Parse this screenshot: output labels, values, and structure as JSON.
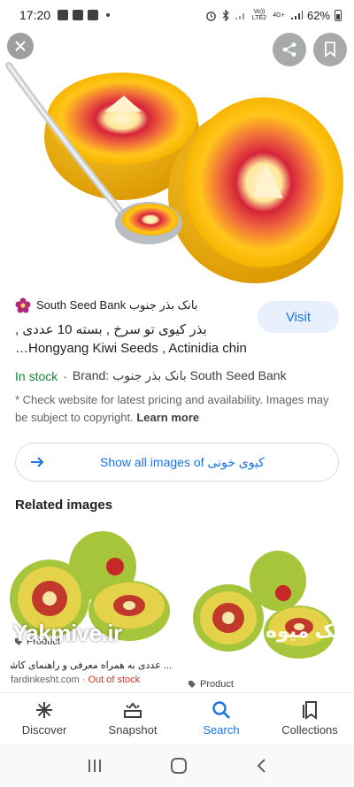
{
  "status_bar": {
    "time": "17:20",
    "network": "Vo)) LTE2",
    "net_type": "4G+",
    "battery": "62%"
  },
  "hero": {
    "icons": [
      "close-icon",
      "share-icon",
      "bookmark-icon"
    ]
  },
  "result": {
    "source_name": "South Seed Bank بانک بذر جنوب",
    "visit_label": "Visit",
    "title_line1": "بذر کیوی تو سرخ , بسته 10 عددی ,",
    "title_line2": "…Hongyang Kiwi Seeds , Actinidia chin",
    "stock": "In stock",
    "separator": "·",
    "brand": "Brand: بانک بذر جنوب South Seed Bank",
    "disclaimer": "* Check website for pricing and availability. Images may be subject to copyright.",
    "disclaimer_text": "* Check website for latest pricing and availability. Images may be subject to copyright. ",
    "learn_more": "Learn more"
  },
  "show_all": {
    "label": "Show all images of کیوی خونی"
  },
  "related": {
    "heading": "Related images",
    "cards": [
      {
        "badge": "Product",
        "caption": "... عددی به همراه معرفی و راهنمای کاشت",
        "source": "fardinkesht.com",
        "sep": " · ",
        "status": "Out of stock"
      },
      {
        "badge": "Product"
      }
    ],
    "watermark": "Yakmive.ir",
    "watermark2": "یک میوه"
  },
  "bottom_nav": {
    "items": [
      {
        "label": "Discover",
        "icon": "asterisk-icon",
        "active": false
      },
      {
        "label": "Snapshot",
        "icon": "snapshot-icon",
        "active": false
      },
      {
        "label": "Search",
        "icon": "search-icon",
        "active": true
      },
      {
        "label": "Collections",
        "icon": "collections-icon",
        "active": false
      }
    ]
  },
  "colors": {
    "accent": "#1a73e8",
    "in_stock": "#188038",
    "out_of_stock": "#d93025",
    "visit_bg": "#e8f0fe"
  }
}
